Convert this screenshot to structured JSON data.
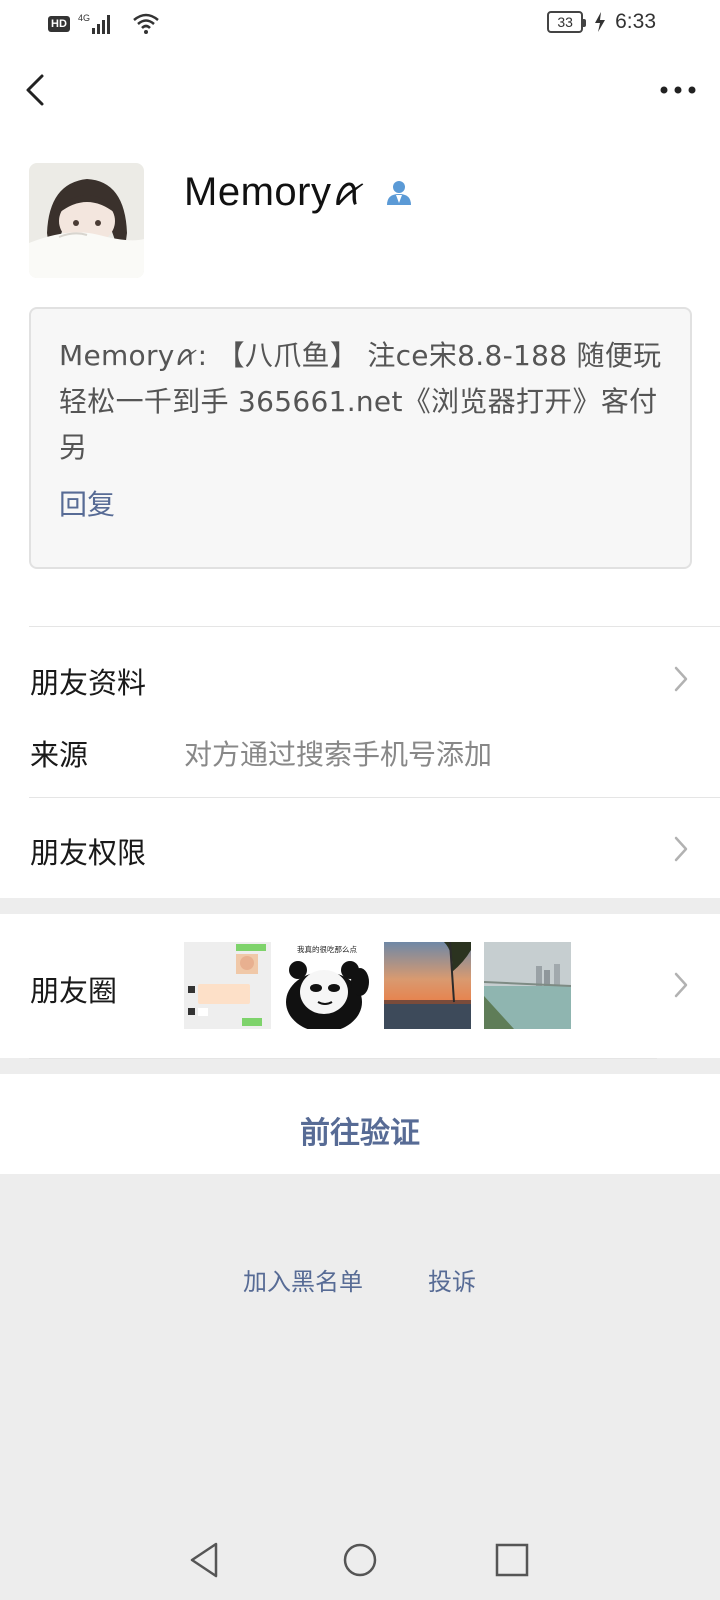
{
  "status_bar": {
    "hd": "HD",
    "network": "4G",
    "battery": "33",
    "time": "6:33"
  },
  "header": {
    "back_icon": "chevron-left-icon",
    "more_icon": "more-dots-icon"
  },
  "profile": {
    "name": "Memoryꪁ",
    "verify_icon": "person-icon"
  },
  "message": {
    "text": "Memoryꪁ: 【八爪鱼】 注ce宋8.8-188 随便玩 轻松一千到手  365661.net《浏览器打开》客付另",
    "reply": "回复"
  },
  "rows": {
    "friend_info": "朋友资料",
    "source_label": "来源",
    "source_value": "对方通过搜索手机号添加",
    "permissions": "朋友权限",
    "moments": "朋友圈"
  },
  "moments_thumbs": {
    "panda_caption": "我真的很吃那么点"
  },
  "actions": {
    "verify": "前往验证",
    "blacklist": "加入黑名单",
    "report": "投诉"
  },
  "colors": {
    "link": "#576b95",
    "background": "#ededed"
  }
}
